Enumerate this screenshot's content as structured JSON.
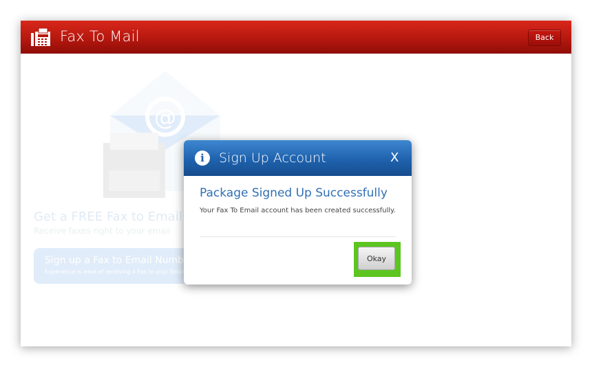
{
  "header": {
    "title": "Fax To Mail",
    "back_label": "Back",
    "color": "#c31d14"
  },
  "promo": {
    "title": "Get a FREE Fax to Email Num",
    "subtitle": "Receive faxes right to your email",
    "button_title": "Sign up a Fax to Email Number",
    "button_sub": "Experience is ease of receiving a Fax to your Emai"
  },
  "dialog": {
    "title": "Sign Up Account",
    "close_label": "X",
    "message_title": "Package Signed Up Successfully",
    "message": "Your Fax To Email account has been created successfully.",
    "ok_label": "Okay",
    "header_color": "#1f62ad",
    "highlight_color": "#5cc51f"
  },
  "icons": {
    "app_logo": "fax-machine-icon",
    "dialog_info": "info-icon",
    "hero": "fax-email-envelope-icon"
  }
}
